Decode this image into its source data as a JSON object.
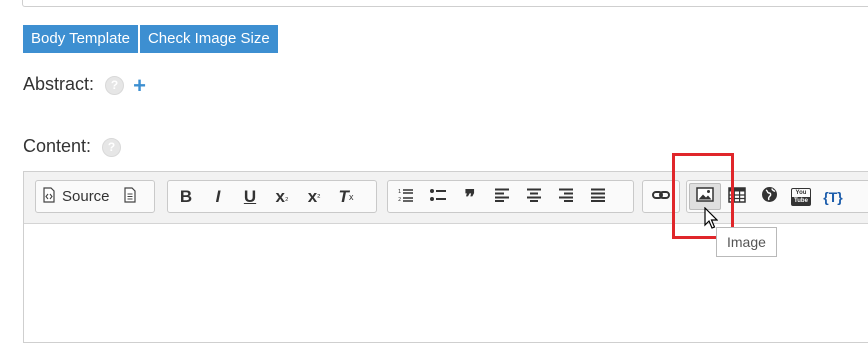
{
  "buttons": {
    "body_template": "Body Template",
    "check_image_size": "Check Image Size"
  },
  "fields": {
    "abstract_label": "Abstract:",
    "content_label": "Content:",
    "help_glyph": "?",
    "add_glyph": "+"
  },
  "toolbar": {
    "source_label": "Source",
    "bold": "B",
    "italic": "I",
    "underline": "U",
    "subscript": "x",
    "subscript_mark": "₂",
    "superscript": "x",
    "superscript_mark": "²",
    "remove_format": "T",
    "remove_format_mark": "x",
    "blockquote": "❞",
    "placeholder_label": "{T}",
    "youtube_top": "You",
    "youtube_bottom": "Tube"
  },
  "tooltip": {
    "text": "Image"
  },
  "colors": {
    "accent": "#3d8fd1",
    "highlight": "#e0262a"
  },
  "icons": [
    "source-icon",
    "templates-icon",
    "numbered-list-icon",
    "bulleted-list-icon",
    "blockquote-icon",
    "align-left-icon",
    "align-center-icon",
    "align-right-icon",
    "justify-icon",
    "link-icon",
    "image-icon",
    "table-icon",
    "globe-icon",
    "youtube-icon",
    "placeholder-icon"
  ]
}
